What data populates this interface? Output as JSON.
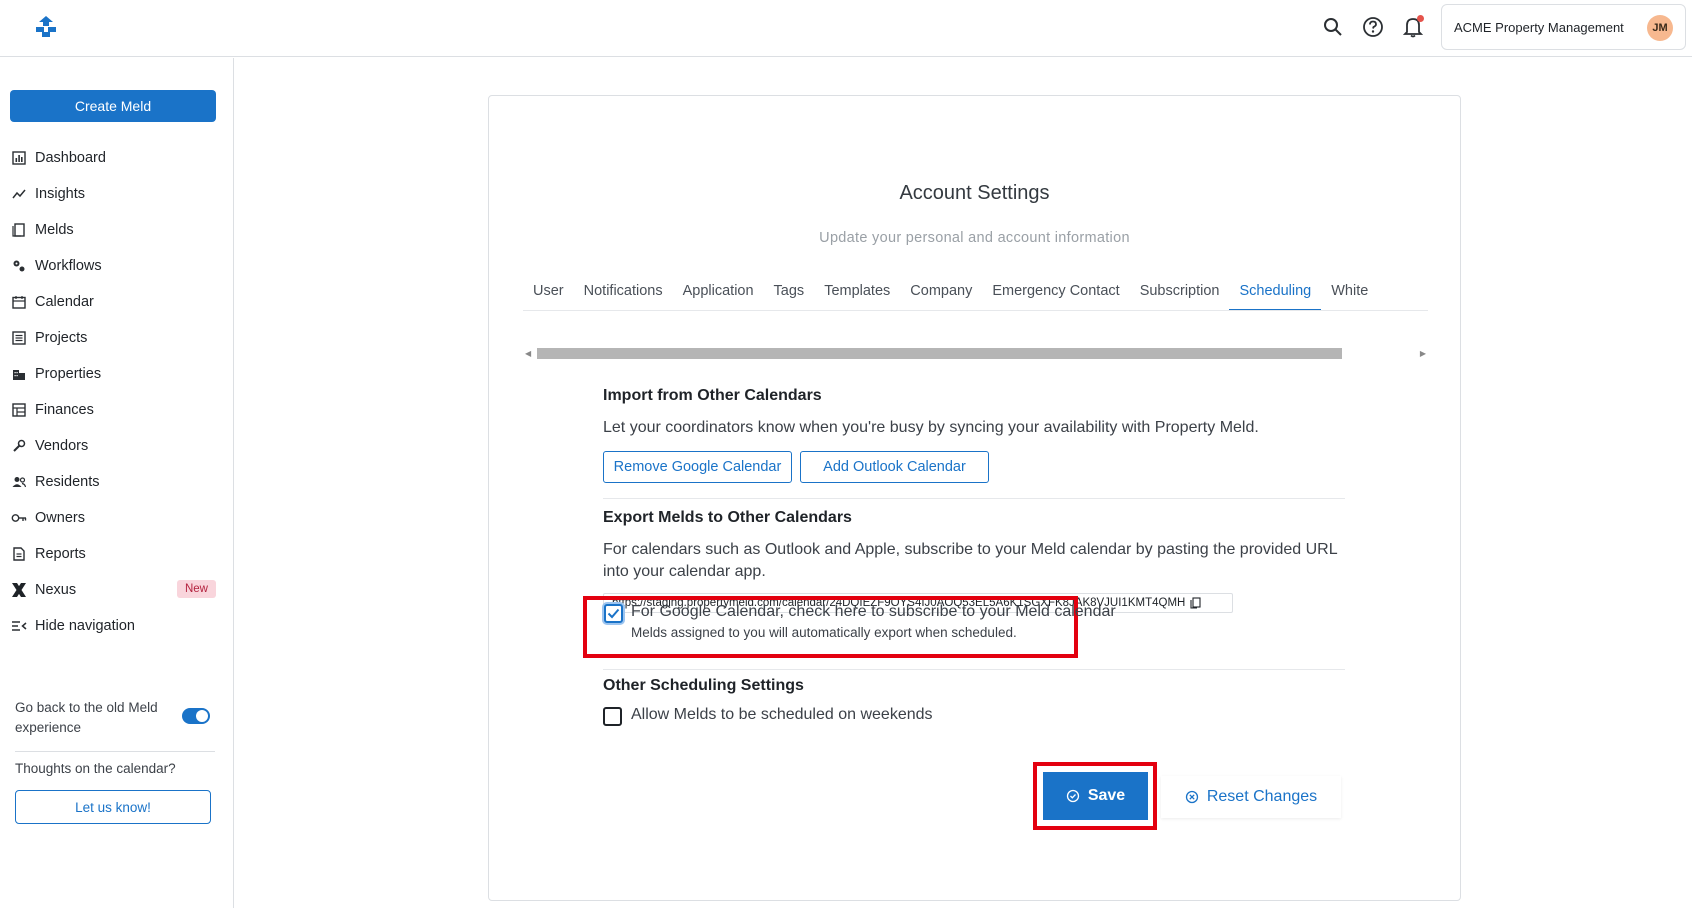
{
  "topbar": {
    "account_name": "ACME Property Management",
    "avatar_initials": "JM",
    "icons": [
      "logo-icon",
      "search-icon",
      "help-icon",
      "bell-icon"
    ]
  },
  "sidebar": {
    "create_label": "Create Meld",
    "items": [
      {
        "label": "Dashboard",
        "icon": "dashboard-icon"
      },
      {
        "label": "Insights",
        "icon": "insights-icon"
      },
      {
        "label": "Melds",
        "icon": "melds-icon"
      },
      {
        "label": "Workflows",
        "icon": "workflows-icon"
      },
      {
        "label": "Calendar",
        "icon": "calendar-icon"
      },
      {
        "label": "Projects",
        "icon": "projects-icon"
      },
      {
        "label": "Properties",
        "icon": "properties-icon"
      },
      {
        "label": "Finances",
        "icon": "finances-icon"
      },
      {
        "label": "Vendors",
        "icon": "vendors-icon"
      },
      {
        "label": "Residents",
        "icon": "residents-icon"
      },
      {
        "label": "Owners",
        "icon": "owners-icon"
      },
      {
        "label": "Reports",
        "icon": "reports-icon"
      },
      {
        "label": "Nexus",
        "icon": "nexus-icon",
        "badge": "New"
      },
      {
        "label": "Hide navigation",
        "icon": "hide-nav-icon"
      }
    ],
    "old_experience_text": "Go back to the old Meld experience",
    "old_experience_toggle_on": true,
    "thoughts_text": "Thoughts on the calendar?",
    "feedback_label": "Let us know!"
  },
  "main": {
    "title": "Account Settings",
    "subtitle": "Update your personal and account information",
    "tabs": [
      "User",
      "Notifications",
      "Application",
      "Tags",
      "Templates",
      "Company",
      "Emergency Contact",
      "Subscription",
      "Scheduling",
      "White"
    ],
    "active_tab": "Scheduling",
    "import": {
      "title": "Import from Other Calendars",
      "text": "Let your coordinators know when you're busy by syncing your availability with Property Meld.",
      "remove_google_label": "Remove Google Calendar",
      "add_outlook_label": "Add Outlook Calendar"
    },
    "export": {
      "title": "Export Melds to Other Calendars",
      "text": "For calendars such as Outlook and Apple, subscribe to your Meld calendar by pasting the provided URL into your calendar app.",
      "url": "https://staging.propertymeld.com/calendar/24DQIEZF9OYS4IJ0AOQ53EL5A6K1SGXFK8JAK8VJUI1KMT4QMH",
      "google_checkbox_label": "For Google Calendar, check here to subscribe to your Meld calendar",
      "google_checkbox_sub": "Melds assigned to you will automatically export when scheduled.",
      "google_checked": true
    },
    "other": {
      "title": "Other Scheduling Settings",
      "weekends_label": "Allow Melds to be scheduled on weekends",
      "weekends_checked": false
    },
    "save_label": "Save",
    "reset_label": "Reset Changes"
  },
  "colors": {
    "accent": "#1a73c8",
    "highlight": "#e3000f",
    "badge_bg": "#f9d5dc",
    "badge_text": "#b4233f"
  }
}
